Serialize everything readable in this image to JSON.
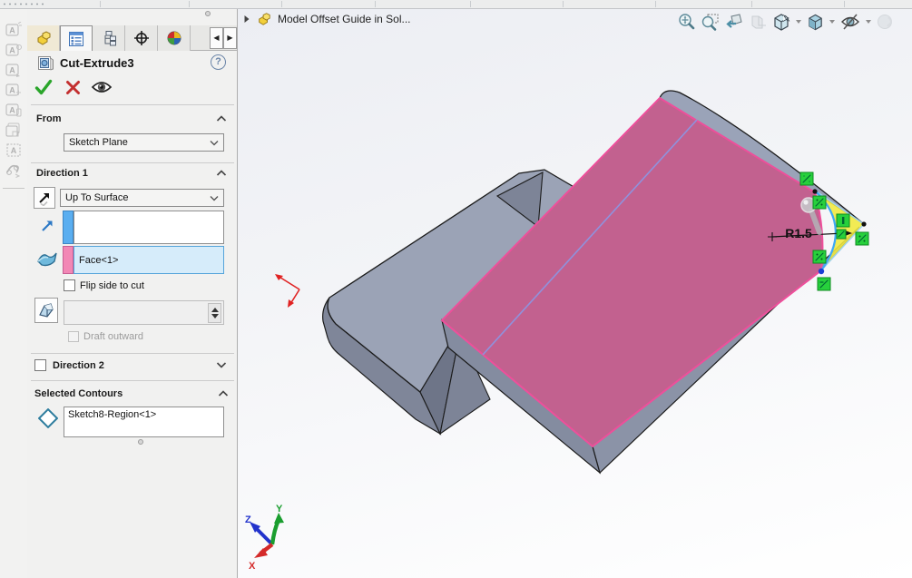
{
  "manager_tabs": {
    "tabs": [
      {
        "name": "feature-manager"
      },
      {
        "name": "property-manager",
        "active": true
      },
      {
        "name": "configuration-manager"
      },
      {
        "name": "dimxpert-manager"
      },
      {
        "name": "display-manager"
      }
    ],
    "scroll_left": "◀",
    "scroll_right": "▶"
  },
  "left_toolbar": {
    "icons": [
      "annotation-tool-1",
      "annotation-tool-2",
      "annotation-tool-3",
      "annotation-tool-4",
      "annotation-tool-5",
      "annotation-tool-6",
      "annotation-tool-7",
      "annotation-tool-8"
    ]
  },
  "property_manager": {
    "title": "Cut-Extrude3",
    "help": "?",
    "from": {
      "label": "From",
      "plane": "Sketch Plane"
    },
    "direction1": {
      "label": "Direction 1",
      "end_condition": "Up To Surface",
      "direction_reference": "",
      "face_reference": "Face<1>",
      "flip_side_to_cut": "Flip side to cut",
      "draft_angle": "",
      "draft_outward": "Draft outward"
    },
    "direction2": {
      "label": "Direction 2"
    },
    "selected_contours": {
      "label": "Selected Contours",
      "items": [
        "Sketch8-Region<1>"
      ]
    }
  },
  "viewport": {
    "flyout_tree_label": "Model Offset Guide in Sol...",
    "dimension": "R1.5",
    "triad": {
      "x": "X",
      "y": "Y",
      "z": "Z"
    },
    "headsup_icons": [
      "zoom-to-fit",
      "zoom-to-area",
      "previous-view",
      "section-view",
      "display-style",
      "view-orientation",
      "hide-show-items",
      "edit-appearance"
    ]
  },
  "colors": {
    "selected_face": "#c2618f",
    "highlight": "#f2ea3e",
    "sketch_line": "#3fa9f5",
    "relation_green": "#27d03c",
    "selection_field_bg": "#d6ecfa",
    "selection_field_border": "#55a4da"
  }
}
